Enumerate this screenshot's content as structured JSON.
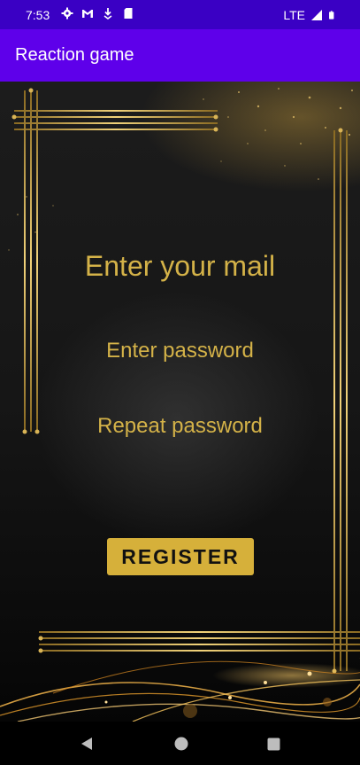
{
  "status_bar": {
    "time": "7:53",
    "network": "LTE",
    "left_icons": [
      "gear-icon",
      "gmail-icon",
      "download-icon",
      "sd-card-icon"
    ],
    "right_icons": [
      "signal-icon",
      "battery-icon"
    ]
  },
  "app_bar": {
    "title": "Reaction game",
    "color": "#5e00ea"
  },
  "form": {
    "email_placeholder": "Enter your mail",
    "password_placeholder": "Enter password",
    "repeat_password_placeholder": "Repeat password",
    "register_label": "REGISTER",
    "text_color": "#d4b248",
    "button_color": "#d6b03a"
  },
  "nav_bar": {
    "icons": [
      "back-icon",
      "home-icon",
      "recent-apps-icon"
    ]
  }
}
